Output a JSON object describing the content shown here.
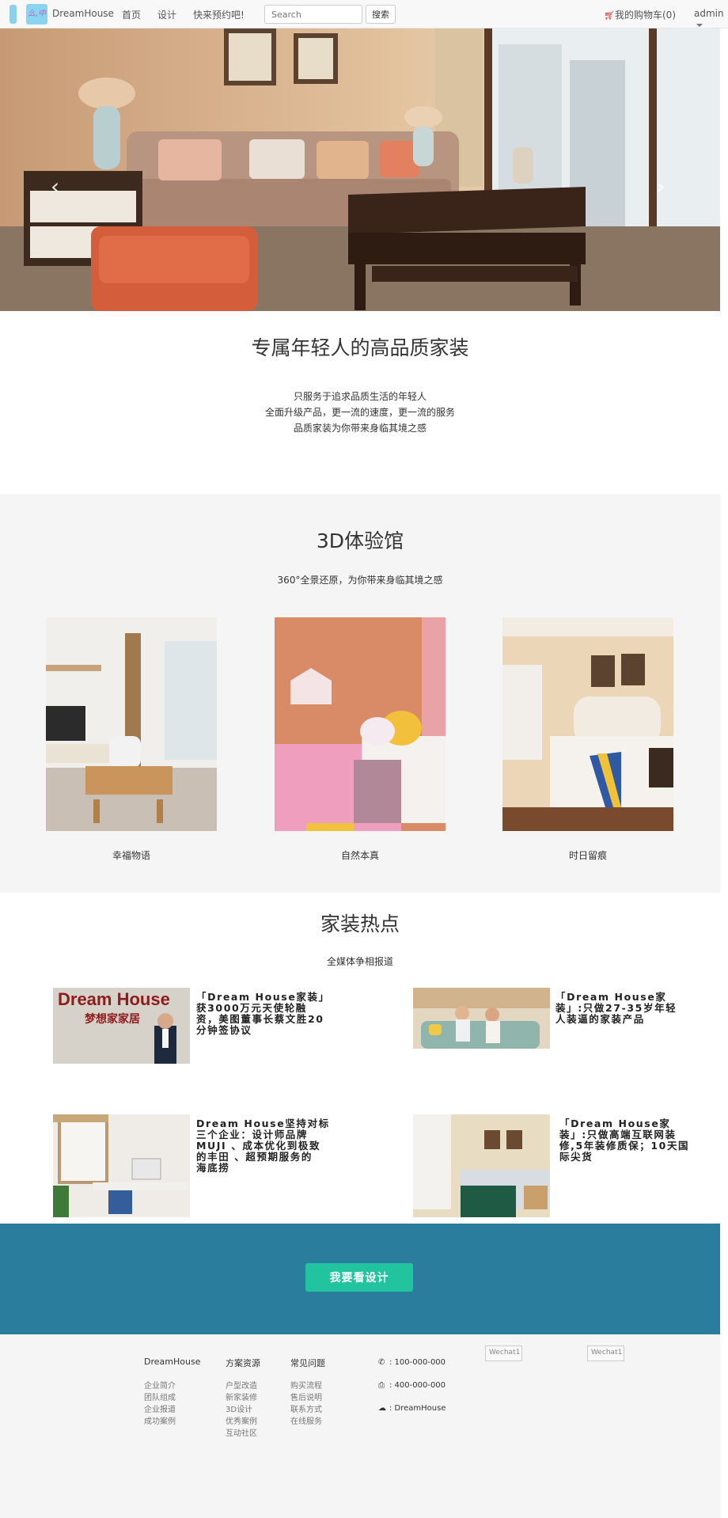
{
  "navbar": {
    "logo_text": "么,中",
    "brand": "DreamHouse",
    "links": [
      "首页",
      "设计",
      "快来预约吧!"
    ],
    "search_placeholder": "Search",
    "search_button": "搜索",
    "cart_label": "我的购物车(0)",
    "user": "admin"
  },
  "carousel": {
    "prev_icon": "‹",
    "next_icon": "›",
    "dot_count": 3,
    "active_dot": 1
  },
  "intro": {
    "title": "专属年轻人的高品质家装",
    "lines": [
      "只服务于追求品质生活的年轻人",
      "全面升级产品，更一流的速度，更一流的服务",
      "品质家装为你带来身临其境之感"
    ]
  },
  "gallery": {
    "title": "3D体验馆",
    "subtitle": "360°全景还原，为你带来身临其境之感",
    "items": [
      {
        "label": "幸福物语"
      },
      {
        "label": "自然本真"
      },
      {
        "label": "时日留痕"
      }
    ]
  },
  "news": {
    "title": "家装热点",
    "subtitle": "全媒体争相报道",
    "banner_title": "Dream House",
    "banner_subtitle": "梦想家家居",
    "items": [
      {
        "lines": [
          "「Dream House家装」",
          "获3000万元天使轮融",
          "资，美图董事长蔡文胜20",
          "分钟签协议"
        ]
      },
      {
        "lines": [
          "「Dream House家",
          "装」:只做27-35岁年轻",
          "人装逼的家装产品"
        ]
      },
      {
        "lines": [
          "Dream House坚持对标",
          "三个企业：设计师品牌",
          "MUJI 、成本优化到极致",
          "的丰田 、超预期服务的",
          "海底捞"
        ]
      },
      {
        "lines": [
          "「Dream House家",
          "装」:只做高端互联网装",
          "修,5年装修质保；10天国",
          "际尖货"
        ]
      }
    ]
  },
  "cta": {
    "button": "我要看设计"
  },
  "footer": {
    "columns": [
      {
        "title": "DreamHouse",
        "links": [
          "企业简介",
          "团队组成",
          "企业报道",
          "成功案例"
        ]
      },
      {
        "title": "方案资源",
        "links": [
          "户型改造",
          "新家装修",
          "3D设计",
          "优秀案例",
          "互动社区"
        ]
      },
      {
        "title": "常见问题",
        "links": [
          "购买流程",
          "售后说明",
          "联系方式",
          "在线服务"
        ]
      }
    ],
    "contacts": [
      {
        "icon": "phone-icon",
        "glyph": "✆",
        "text": ": 100-000-000"
      },
      {
        "icon": "fax-icon",
        "glyph": "⎙",
        "text": ": 400-000-000"
      },
      {
        "icon": "wechat-icon",
        "glyph": "☁",
        "text": ": DreamHouse"
      }
    ],
    "images": [
      "Wechat1",
      "Wechat1"
    ]
  },
  "colors": {
    "navbar_bg": "#f8f8f8",
    "cta_band": "#2b7d9e",
    "cta_button": "#22c4a0",
    "cart_icon": "#c9302c"
  }
}
